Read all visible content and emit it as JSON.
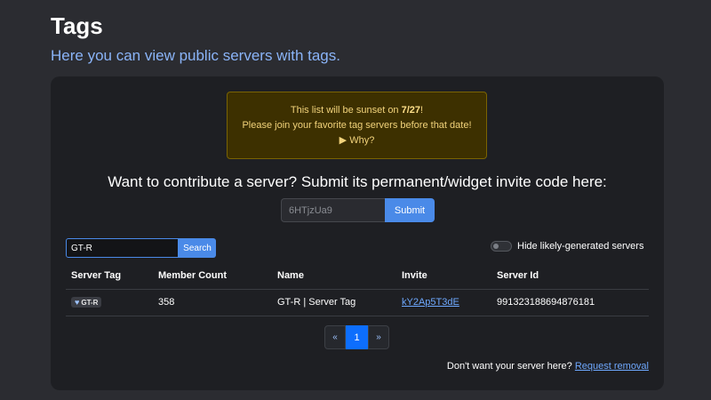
{
  "header": {
    "title": "Tags",
    "subtitle": "Here you can view public servers with tags."
  },
  "alert": {
    "line1_prefix": "This list will be sunset on ",
    "line1_date": "7/27",
    "line1_suffix": "!",
    "line2": "Please join your favorite tag servers before that date!",
    "why_label": "▶ Why?"
  },
  "contribute": {
    "heading": "Want to contribute a server? Submit its permanent/widget invite code here:",
    "input_placeholder": "6HTjzUa9",
    "submit_label": "Submit"
  },
  "search": {
    "value": "GT-R",
    "button_label": "Search"
  },
  "toggle": {
    "label": "Hide likely-generated servers",
    "checked": false
  },
  "table": {
    "columns": [
      "Server Tag",
      "Member Count",
      "Name",
      "Invite",
      "Server Id"
    ],
    "rows": [
      {
        "tag_icon": "heart-icon",
        "tag": "GT-R",
        "member_count": "358",
        "name": "GT-R | Server Tag",
        "invite": "kY2Ap5T3dE",
        "server_id": "991323188694876181"
      }
    ]
  },
  "pagination": {
    "prev": "«",
    "current": "1",
    "next": "»"
  },
  "footer": {
    "text": "Don't want your server here? ",
    "link": "Request removal"
  },
  "colors": {
    "background": "#2b2c31",
    "card": "#1e1f23",
    "accent": "#4a8ae8",
    "link": "#6ea8fe",
    "alert_bg": "#3d3000"
  }
}
